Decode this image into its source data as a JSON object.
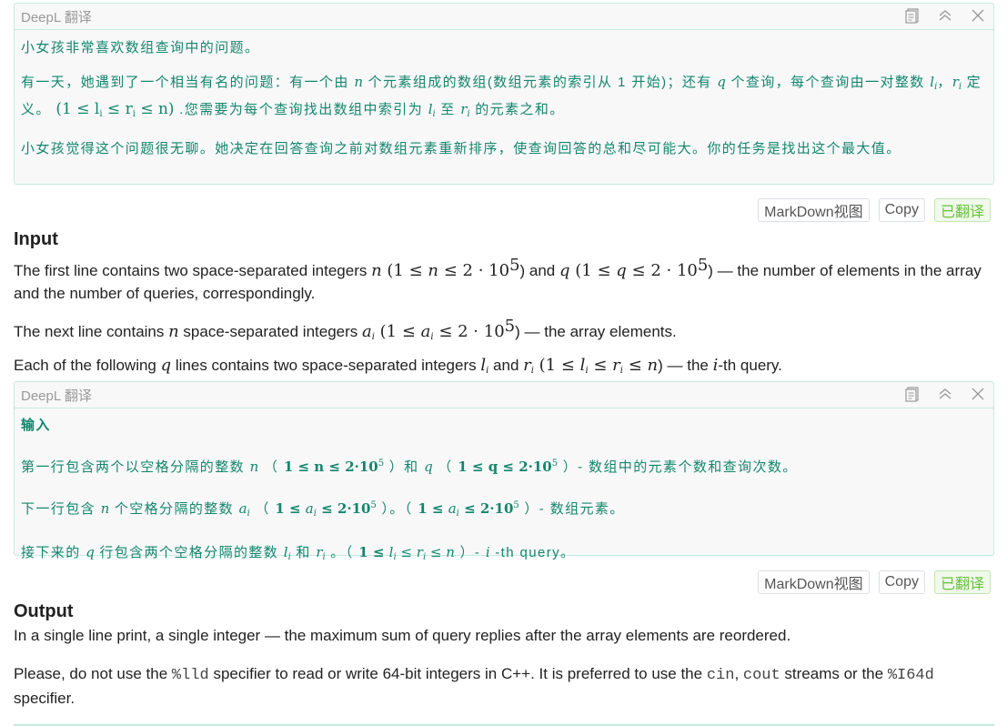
{
  "panel1": {
    "title": "DeepL 翻译",
    "icons": [
      "copy-icon",
      "collapse-icon",
      "close-icon"
    ],
    "p1": "小女孩非常喜欢数组查询中的问题。",
    "p2_a": "有一天，她遇到了一个相当有名的问题：有一个由",
    "p2_n": "n",
    "p2_b": "个元素组成的数组(数组元素的索引从 1 开始)；还有",
    "p2_q": "q",
    "p2_c": "个查询，每个查询由一对整数",
    "p2_l": "l",
    "p2_i": "i",
    "p2_sep": "，",
    "p2_r": "r",
    "p2_d": "定义。",
    "p2_math": "(1 ≤ l",
    "p2_math2": " ≤ r",
    "p2_math3": " ≤ n)",
    "p2_e": ".您需要为每个查询找出数组中索引为",
    "p2_f": "至",
    "p2_g": "的元素之和。",
    "p3": "小女孩觉得这个问题很无聊。她决定在回答查询之前对数组元素重新排序，使查询回答的总和尽可能大。你的任务是找出这个最大值。"
  },
  "buttons1": {
    "markdown": "MarkDown视图",
    "copy": "Copy",
    "translated": "已翻译"
  },
  "input": {
    "title": "Input",
    "l1_a": "The first line contains two space-separated integers ",
    "n": "n",
    "l1_b": " (1 ≤ ",
    "l1_c": " ≤ 2 · 10",
    "exp": "5",
    "l1_d": ") and ",
    "q": "q",
    "l1_e": " (1 ≤ ",
    "l1_f": " ≤ 2 · 10",
    "l1_g": ") — the number of elements in the array and the number of queries, correspondingly.",
    "l2_a": "The next line contains ",
    "l2_b": " space-separated integers ",
    "a": "a",
    "i": "i",
    "l2_c": " (1 ≤ ",
    "l2_d": " ≤ 2 · 10",
    "l2_e": ") — the array elements.",
    "l3_a": "Each of the following ",
    "l3_b": " lines contains two space-separated integers ",
    "l": "l",
    "l3_c": " and ",
    "r": "r",
    "l3_d": " (1 ≤ ",
    "le": " ≤ ",
    "l3_e": ") — the ",
    "l3_f": "-th query."
  },
  "panel2": {
    "title": "DeepL 翻译",
    "heading": "输入",
    "p1_a": "第一行包含两个以空格分隔的整数",
    "p1_b": "（",
    "p1_math": "1 ≤ n ≤ 2·10",
    "p1_c": "）和",
    "p1_math2": "1 ≤ q ≤ 2·10",
    "p1_d": "）- 数组中的元素个数和查询次数。",
    "p2_a": "下一行包含",
    "p2_b": "个空格分隔的整数",
    "p2_c": "）。（",
    "p2_d": "）- 数组元素。",
    "p3_a": "接下来的",
    "p3_b": "行包含两个空格分隔的整数",
    "p3_c": "和",
    "p3_d": "。（",
    "p3_e": "）-",
    "p3_f": "-th query。",
    "le_2e5": " ≤ 2·10"
  },
  "buttons2": {
    "markdown": "MarkDown视图",
    "copy": "Copy",
    "translated": "已翻译"
  },
  "output": {
    "title": "Output",
    "l1": "In a single line print, a single integer — the maximum sum of query replies after the array elements are reordered.",
    "l2_a": "Please, do not use the ",
    "code1": "%lld",
    "l2_b": " specifier to read or write 64-bit integers in C++. It is preferred to use the ",
    "code2": "cin",
    "l2_c": ", ",
    "code3": "cout",
    "l2_d": " streams or the ",
    "code4": "%I64d",
    "l2_e": " specifier."
  }
}
